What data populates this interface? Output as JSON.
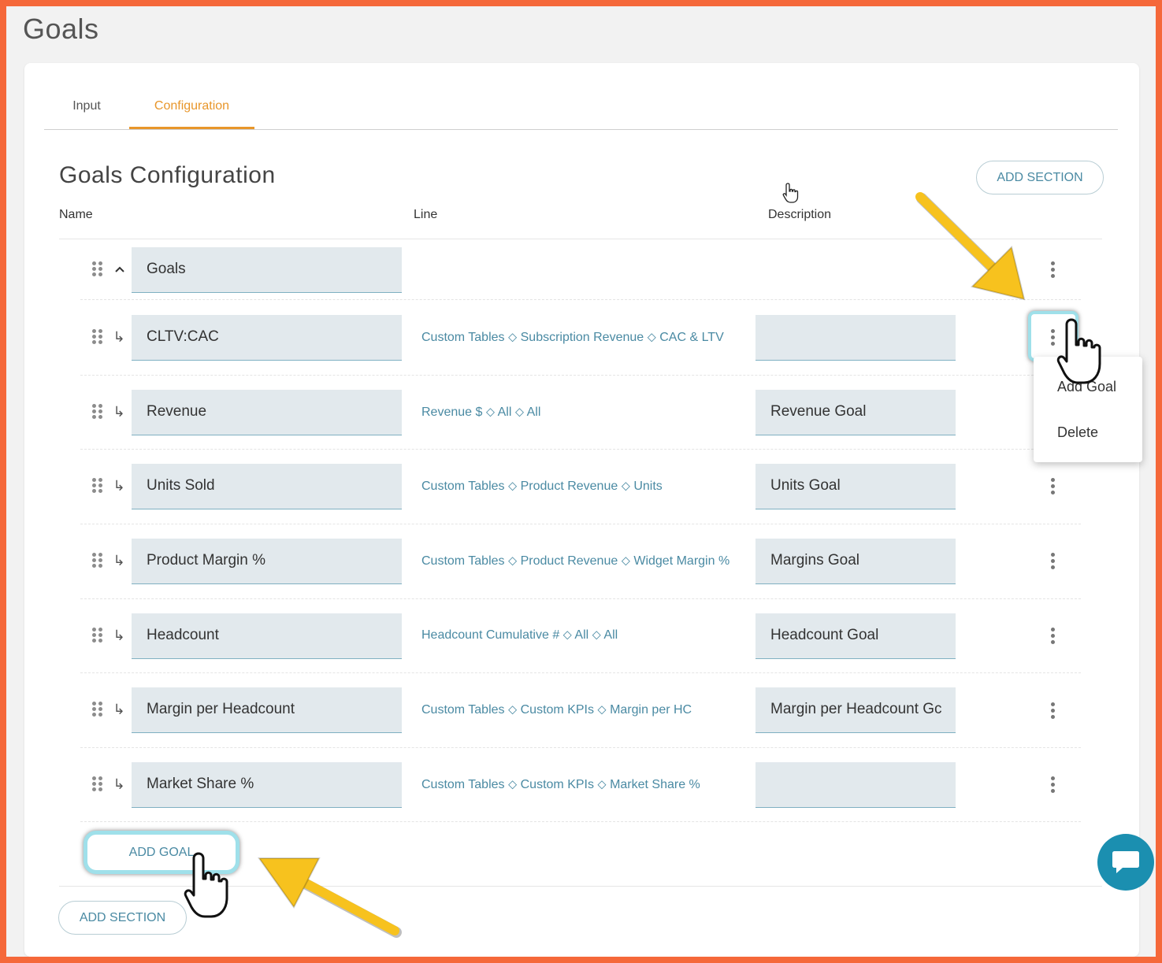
{
  "page": {
    "title": "Goals"
  },
  "tabs": [
    {
      "label": "Input",
      "active": false
    },
    {
      "label": "Configuration",
      "active": true
    }
  ],
  "section": {
    "title": "Goals Configuration",
    "add_section_label": "ADD SECTION",
    "columns": {
      "name": "Name",
      "line": "Line",
      "description": "Description"
    },
    "group": {
      "name": "Goals",
      "expanded": true
    },
    "rows": [
      {
        "name": "CLTV:CAC",
        "line": "Custom Tables ⬦ Subscription Revenue ⬦ CAC & LTV",
        "description": ""
      },
      {
        "name": "Revenue",
        "line": "Revenue $ ⬦ All ⬦ All",
        "description": "Revenue Goal"
      },
      {
        "name": "Units Sold",
        "line": "Custom Tables ⬦ Product Revenue ⬦ Units",
        "description": "Units Goal"
      },
      {
        "name": "Product Margin %",
        "line": "Custom Tables ⬦ Product Revenue ⬦ Widget Margin %",
        "description": "Margins Goal"
      },
      {
        "name": "Headcount",
        "line": "Headcount Cumulative # ⬦ All ⬦ All",
        "description": "Headcount Goal"
      },
      {
        "name": "Margin per Headcount",
        "line": "Custom Tables ⬦ Custom KPIs ⬦ Margin per HC",
        "description": "Margin per Headcount Gc"
      },
      {
        "name": "Market Share %",
        "line": "Custom Tables ⬦ Custom KPIs ⬦ Market Share %",
        "description": ""
      }
    ],
    "add_goal_label": "ADD GOAL"
  },
  "context_menu": {
    "items": [
      "Add Goal",
      "Delete"
    ]
  },
  "footer": {
    "add_section_label": "ADD SECTION"
  },
  "colors": {
    "accent": "#e8962a",
    "link": "#4a8aa3",
    "field_bg": "#e2e9ed",
    "frame": "#f5683a",
    "highlight": "#9fe0ea",
    "annotation_arrow": "#f7c21e",
    "chat": "#1b8fb0"
  },
  "icons": [
    "drag-handle-icon",
    "chevron-up-icon",
    "child-arrow-icon",
    "more-vert-icon",
    "pointer-hand-icon",
    "chat-icon",
    "annotation-arrow"
  ]
}
